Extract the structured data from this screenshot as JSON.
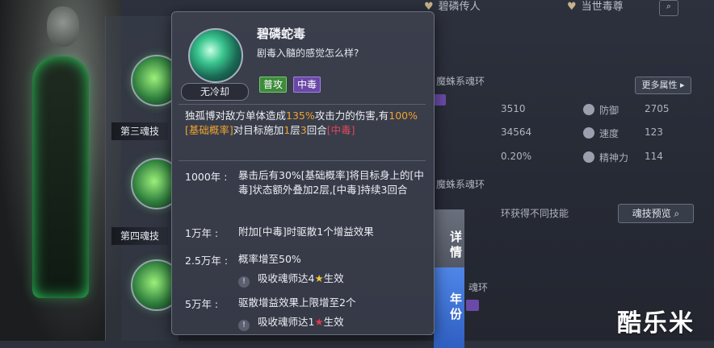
{
  "background": {
    "tabs": [
      {
        "label": "碧磷传人",
        "icon": "heart-icon"
      },
      {
        "label": "当世毒尊",
        "icon": "heart-icon"
      }
    ],
    "skill_slots": [
      {
        "label": "第三魂技"
      },
      {
        "label": "第四魂技"
      }
    ],
    "soul_ring_lines": [
      "魔蛛系魂环",
      "魔蛛系魂环",
      "魂环"
    ],
    "stats": [
      {
        "partial": "3510",
        "name": "防御",
        "value": "2705"
      },
      {
        "partial": "34564",
        "name": "速度",
        "value": "123"
      },
      {
        "partial": "0.20%",
        "name": "精神力",
        "value": "114"
      }
    ],
    "more_attributes_label": "更多属性",
    "partial_hint": "环获得不同技能",
    "skill_preview_label": "魂技预览",
    "detail_button": "详情",
    "year_button": "年份",
    "watermark": "酷乐米"
  },
  "popup": {
    "skill_name": "碧磷蛇毒",
    "skill_subtitle": "剧毒入髓的感觉怎么样?",
    "cooldown_label": "无冷却",
    "tags": [
      {
        "label": "普攻",
        "color": "#3f8a3d"
      },
      {
        "label": "中毒",
        "color": "#6a48a6"
      }
    ],
    "description": {
      "p1": "独孤博对敌方单体造成",
      "v1": "135%",
      "p2": "攻击力的伤害,有",
      "v2": "100%",
      "v3": "[基础概率]",
      "p3": "对目标施加",
      "v4": "1",
      "p4": "层",
      "v5": "3",
      "p5": "回合",
      "v6": "[中毒]"
    },
    "tiers": [
      {
        "year": "1000年 :",
        "content": "暴击后有30%[基础概率]将目标身上的[中毒]状态额外叠加2层,[中毒]持续3回合"
      },
      {
        "year": "1万年 :",
        "content": "附加[中毒]时驱散1个增益效果"
      },
      {
        "year": "2.5万年 :",
        "content": "概率增至50%",
        "condition": {
          "prefix": "吸收魂师达4",
          "star": "gold",
          "suffix": "生效"
        }
      },
      {
        "year": "5万年 :",
        "content": "驱散增益效果上限增至2个",
        "condition": {
          "prefix": "吸收魂师达1",
          "star": "red",
          "suffix": "生效"
        }
      }
    ],
    "colors": {
      "highlight_orange": "#f0a330",
      "highlight_red": "#e0475a"
    }
  }
}
